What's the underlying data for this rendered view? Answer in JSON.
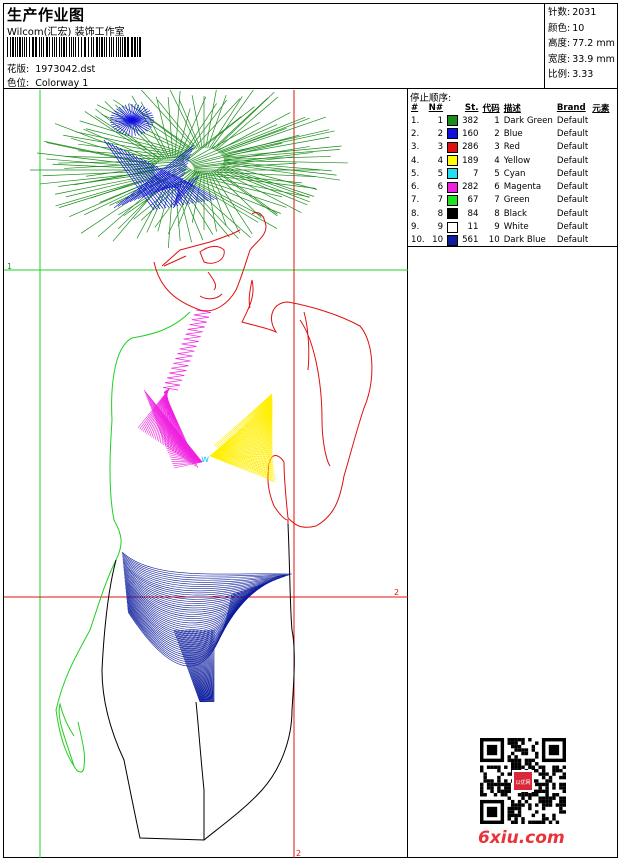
{
  "header": {
    "title": "生产作业图",
    "company": "Wilcom(汇宏) 装饰工作室",
    "design_label": "花版:",
    "design_value": "1973042.dst",
    "colorway_label": "色位:",
    "colorway_value": "Colorway 1"
  },
  "stats": [
    {
      "label": "针数:",
      "value": "2031"
    },
    {
      "label": "颜色:",
      "value": "10"
    },
    {
      "label": "高度:",
      "value": "77.2 mm"
    },
    {
      "label": "宽度:",
      "value": "33.9 mm"
    },
    {
      "label": "比例:",
      "value": "3.33"
    }
  ],
  "legend": {
    "heading": "停止顺序:",
    "columns": [
      "#",
      "N#",
      "St.",
      "代码",
      "描述",
      "Brand",
      "元素"
    ],
    "rows": [
      {
        "idx": "1.",
        "n": "1",
        "st": "382",
        "code": "1",
        "desc": "Dark Green",
        "brand": "Default",
        "color": "#1a8c1a"
      },
      {
        "idx": "2.",
        "n": "2",
        "st": "160",
        "code": "2",
        "desc": "Blue",
        "brand": "Default",
        "color": "#1010e0"
      },
      {
        "idx": "3.",
        "n": "3",
        "st": "286",
        "code": "3",
        "desc": "Red",
        "brand": "Default",
        "color": "#e01010"
      },
      {
        "idx": "4.",
        "n": "4",
        "st": "189",
        "code": "4",
        "desc": "Yellow",
        "brand": "Default",
        "color": "#ffff00"
      },
      {
        "idx": "5.",
        "n": "5",
        "st": "7",
        "code": "5",
        "desc": "Cyan",
        "brand": "Default",
        "color": "#20e0f0"
      },
      {
        "idx": "6.",
        "n": "6",
        "st": "282",
        "code": "6",
        "desc": "Magenta",
        "brand": "Default",
        "color": "#f020e0"
      },
      {
        "idx": "7.",
        "n": "7",
        "st": "67",
        "code": "7",
        "desc": "Green",
        "brand": "Default",
        "color": "#20e020"
      },
      {
        "idx": "8.",
        "n": "8",
        "st": "84",
        "code": "8",
        "desc": "Black",
        "brand": "Default",
        "color": "#000000"
      },
      {
        "idx": "9.",
        "n": "9",
        "st": "11",
        "code": "9",
        "desc": "White",
        "brand": "Default",
        "color": "#ffffff"
      },
      {
        "idx": "10.",
        "n": "10",
        "st": "561",
        "code": "10",
        "desc": "Dark Blue",
        "brand": "Default",
        "color": "#0c1c9c"
      }
    ]
  },
  "guides": {
    "h1": "1",
    "h2": "2",
    "v2": "2"
  },
  "watermark": {
    "site": "6xiu.com",
    "seal_text": "以优网"
  }
}
